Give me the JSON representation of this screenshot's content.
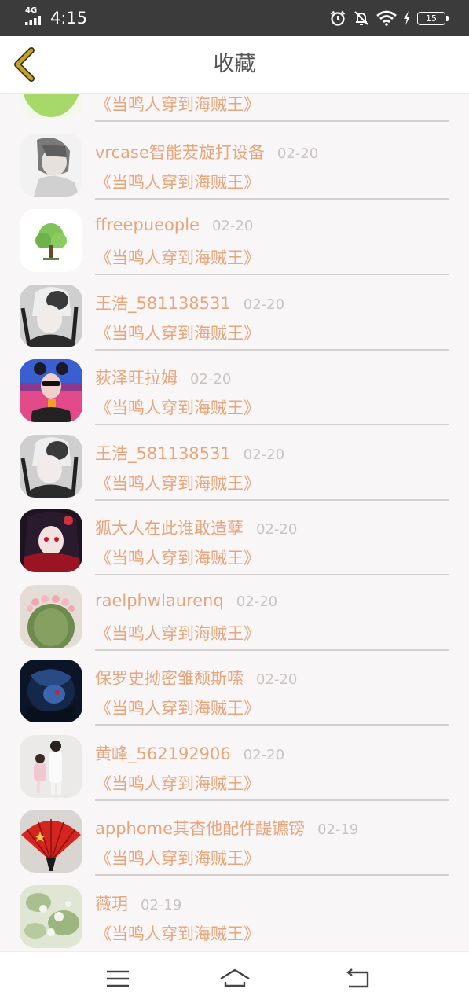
{
  "status_bar": {
    "network": "4G",
    "time": "4:15",
    "battery": "15",
    "icons": [
      "signal-icon",
      "alarm-icon",
      "mute-bell-icon",
      "wifi-icon",
      "charging-icon",
      "battery-icon"
    ]
  },
  "header": {
    "title": "收藏",
    "back_icon": "chevron-left-icon"
  },
  "colors": {
    "accent": "#e8a47a",
    "date": "#c9c4c2",
    "back_chevron": "#c9a227",
    "background": "#f8f6f7"
  },
  "favorites": [
    {
      "user": "",
      "date": "",
      "novel": "《当鸣人穿到海贼王》",
      "avatar": "green-fruit"
    },
    {
      "user": "vrcase智能茇旋打设备",
      "date": "02-20",
      "novel": "《当鸣人穿到海贼王》",
      "avatar": "anime-boy-gray"
    },
    {
      "user": "ffreepueople",
      "date": "02-20",
      "novel": "《当鸣人穿到海贼王》",
      "avatar": "tree"
    },
    {
      "user": "王浩_581138531",
      "date": "02-20",
      "novel": "《当鸣人穿到海贼王》",
      "avatar": "masked-anime"
    },
    {
      "user": "荻泽旺拉姆",
      "date": "02-20",
      "novel": "《当鸣人穿到海贼王》",
      "avatar": "girl-sunglasses"
    },
    {
      "user": "王浩_581138531",
      "date": "02-20",
      "novel": "《当鸣人穿到海贼王》",
      "avatar": "masked-anime"
    },
    {
      "user": "狐大人在此谁敢造孽",
      "date": "02-20",
      "novel": "《当鸣人穿到海贼王》",
      "avatar": "anime-girl-dark"
    },
    {
      "user": "raelphwlaurenq",
      "date": "02-20",
      "novel": "《当鸣人穿到海贼王》",
      "avatar": "cactus"
    },
    {
      "user": "保罗史拗密雏颓斯嗦",
      "date": "02-20",
      "novel": "《当鸣人穿到海贼王》",
      "avatar": "dark-creature"
    },
    {
      "user": "黄峰_562192906",
      "date": "02-20",
      "novel": "《当鸣人穿到海贼王》",
      "avatar": "family-photo"
    },
    {
      "user": "apphome其杳他配件醍镳镑",
      "date": "02-19",
      "novel": "《当鸣人穿到海贼王》",
      "avatar": "red-fan"
    },
    {
      "user": "薇玥",
      "date": "02-19",
      "novel": "《当鸣人穿到海贼王》",
      "avatar": "flowers"
    }
  ],
  "navbar": {
    "icons": [
      "menu-icon",
      "home-icon",
      "back-icon"
    ]
  }
}
